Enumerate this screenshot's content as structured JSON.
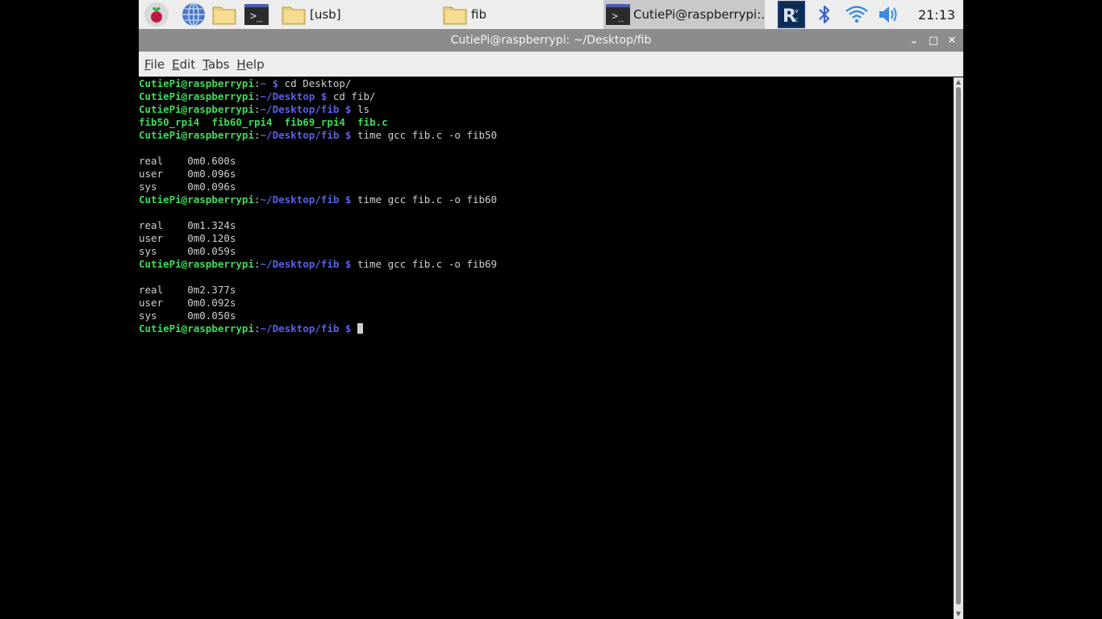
{
  "taskbar": {
    "tasks": [
      {
        "label": "[usb]"
      },
      {
        "label": "fib"
      },
      {
        "label": "CutiePi@raspberrypi:..."
      }
    ],
    "terminal_glyph": ">_",
    "clock": "21:13",
    "icons": [
      "raspberry-menu-icon",
      "browser-globe-icon",
      "file-manager-icon",
      "terminal-icon",
      "vnc-icon",
      "bluetooth-icon",
      "wifi-icon",
      "volume-icon"
    ]
  },
  "window": {
    "title": "CutiePi@raspberrypi: ~/Desktop/fib",
    "controls": {
      "minimize": "⌄",
      "maximize": "□",
      "close": "✕"
    }
  },
  "menu": [
    {
      "underline": "F",
      "rest": "ile"
    },
    {
      "underline": "E",
      "rest": "dit"
    },
    {
      "underline": "T",
      "rest": "abs"
    },
    {
      "underline": "H",
      "rest": "elp"
    }
  ],
  "terminal": {
    "lines": [
      {
        "type": "prompt",
        "host": "CutiePi@raspberrypi",
        "path": "~",
        "cmd": "cd Desktop/"
      },
      {
        "type": "prompt",
        "host": "CutiePi@raspberrypi",
        "path": "~/Desktop",
        "cmd": "cd fib/"
      },
      {
        "type": "prompt",
        "host": "CutiePi@raspberrypi",
        "path": "~/Desktop/fib",
        "cmd": "ls"
      },
      {
        "type": "ls",
        "items": [
          "fib50_rpi4",
          "fib60_rpi4",
          "fib69_rpi4",
          "fib.c"
        ]
      },
      {
        "type": "prompt",
        "host": "CutiePi@raspberrypi",
        "path": "~/Desktop/fib",
        "cmd": "time gcc fib.c -o fib50"
      },
      {
        "type": "text",
        "text": ""
      },
      {
        "type": "text",
        "text": "real    0m0.600s"
      },
      {
        "type": "text",
        "text": "user    0m0.096s"
      },
      {
        "type": "text",
        "text": "sys     0m0.096s"
      },
      {
        "type": "prompt",
        "host": "CutiePi@raspberrypi",
        "path": "~/Desktop/fib",
        "cmd": "time gcc fib.c -o fib60"
      },
      {
        "type": "text",
        "text": ""
      },
      {
        "type": "text",
        "text": "real    0m1.324s"
      },
      {
        "type": "text",
        "text": "user    0m0.120s"
      },
      {
        "type": "text",
        "text": "sys     0m0.059s"
      },
      {
        "type": "prompt",
        "host": "CutiePi@raspberrypi",
        "path": "~/Desktop/fib",
        "cmd": "time gcc fib.c -o fib69"
      },
      {
        "type": "text",
        "text": ""
      },
      {
        "type": "text",
        "text": "real    0m2.377s"
      },
      {
        "type": "text",
        "text": "user    0m0.092s"
      },
      {
        "type": "text",
        "text": "sys     0m0.050s"
      },
      {
        "type": "prompt",
        "host": "CutiePi@raspberrypi",
        "path": "~/Desktop/fib",
        "cmd": "",
        "cursor": true
      }
    ]
  },
  "colors": {
    "prompt_host": "#3ddc5a",
    "prompt_path": "#5a5fea",
    "terminal_bg": "#000000",
    "terminal_fg": "#cfcfcf",
    "panel_bg": "#ededed",
    "titlebar_bg": "#8c8c8c"
  }
}
